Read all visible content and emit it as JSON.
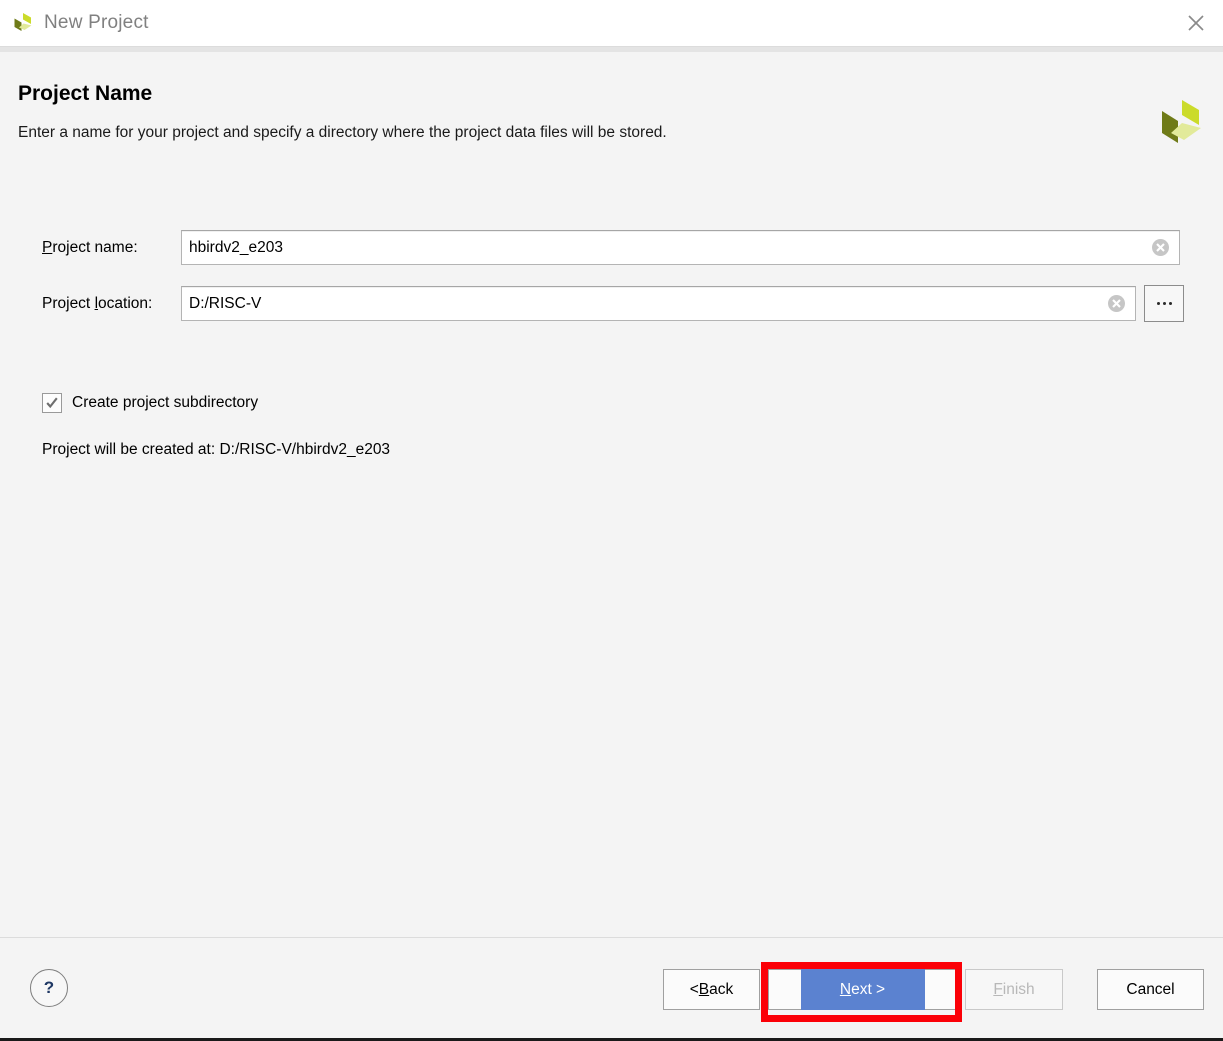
{
  "window": {
    "title": "New Project",
    "logo_icon": "vivado-pinwheel-logo",
    "close_icon": "close-icon"
  },
  "page": {
    "title": "Project Name",
    "subtitle": "Enter a name for your project and specify a directory where the project data files will be stored.",
    "brand_logo_icon": "vivado-pinwheel-logo-large"
  },
  "form": {
    "project_name": {
      "label_prefix": "",
      "label_mnemonic": "P",
      "label_suffix": "roject name:",
      "value": "hbirdv2_e203",
      "placeholder": "",
      "clear_icon": "clear-circle-icon"
    },
    "project_location": {
      "label_prefix": "Project ",
      "label_mnemonic": "l",
      "label_suffix": "ocation:",
      "value": "D:/RISC-V",
      "placeholder": "",
      "clear_icon": "clear-circle-icon",
      "browse_icon": "ellipsis-icon",
      "browse_label": "..."
    },
    "create_subdirectory": {
      "label": "Create project subdirectory",
      "checked": true,
      "check_icon": "checkmark-icon"
    },
    "created_at_text": "Project will be created at: D:/RISC-V/hbirdv2_e203"
  },
  "footer": {
    "help_label": "?",
    "help_icon": "question-mark-icon",
    "back": {
      "prefix": "< ",
      "mnemonic": "B",
      "suffix": "ack"
    },
    "next": {
      "prefix": "",
      "mnemonic": "N",
      "suffix": "ext >"
    },
    "finish": {
      "prefix": "",
      "mnemonic": "F",
      "suffix": "inish",
      "enabled": false
    },
    "cancel": {
      "label": "Cancel"
    }
  },
  "annotation": {
    "highlight_color": "#fb0007",
    "highlight_target": "next-button"
  },
  "colors": {
    "next_button_blue": "#5b82d0",
    "help_text_navy": "#1f3864",
    "title_text_gray": "#808080",
    "window_background": "#f4f4f4",
    "logo_dark_green": "#6f7b18",
    "logo_bright_green": "#cbdb2a",
    "logo_pale_green": "#e2ea9a"
  }
}
